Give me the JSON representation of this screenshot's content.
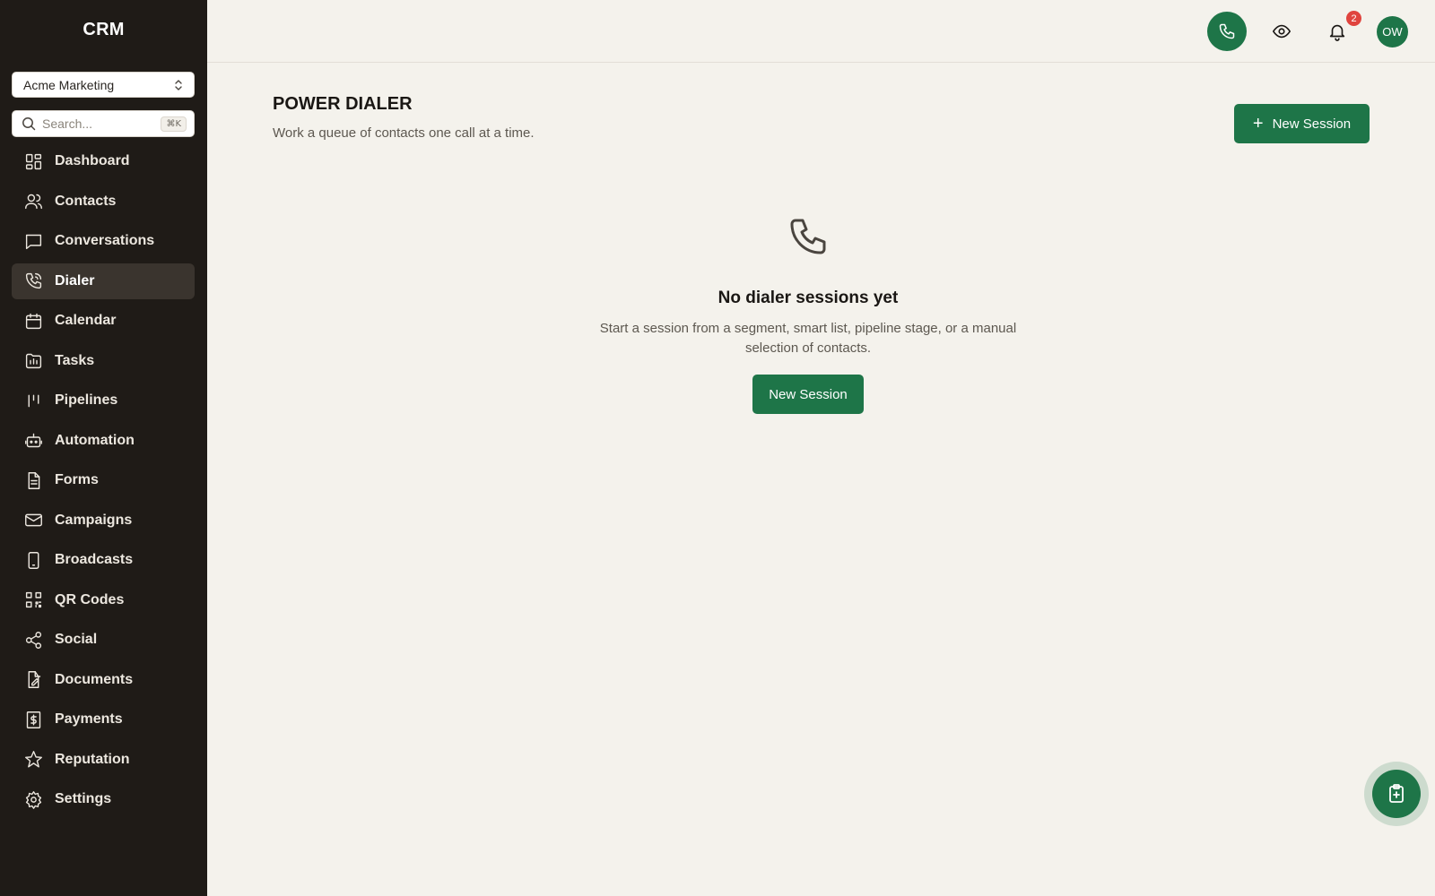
{
  "app": {
    "brand": "CRM"
  },
  "sidebar": {
    "org": "Acme Marketing",
    "search": {
      "placeholder": "Search...",
      "shortcut": "⌘K"
    },
    "items": [
      {
        "label": "Dashboard",
        "icon": "dashboard-icon",
        "active": false
      },
      {
        "label": "Contacts",
        "icon": "contacts-icon",
        "active": false
      },
      {
        "label": "Conversations",
        "icon": "conversations-icon",
        "active": false
      },
      {
        "label": "Dialer",
        "icon": "phone-icon",
        "active": true
      },
      {
        "label": "Calendar",
        "icon": "calendar-icon",
        "active": false
      },
      {
        "label": "Tasks",
        "icon": "tasks-icon",
        "active": false
      },
      {
        "label": "Pipelines",
        "icon": "pipelines-icon",
        "active": false
      },
      {
        "label": "Automation",
        "icon": "robot-icon",
        "active": false
      },
      {
        "label": "Forms",
        "icon": "forms-icon",
        "active": false
      },
      {
        "label": "Campaigns",
        "icon": "mail-icon",
        "active": false
      },
      {
        "label": "Broadcasts",
        "icon": "mobile-icon",
        "active": false
      },
      {
        "label": "QR Codes",
        "icon": "qr-icon",
        "active": false
      },
      {
        "label": "Social",
        "icon": "share-icon",
        "active": false
      },
      {
        "label": "Documents",
        "icon": "document-edit-icon",
        "active": false
      },
      {
        "label": "Payments",
        "icon": "payments-icon",
        "active": false
      },
      {
        "label": "Reputation",
        "icon": "star-icon",
        "active": false
      },
      {
        "label": "Settings",
        "icon": "gear-icon",
        "active": false
      }
    ]
  },
  "topbar": {
    "notifications_count": "2",
    "avatar_initials": "OW"
  },
  "main": {
    "title": "POWER DIALER",
    "subtitle": "Work a queue of contacts one call at a time.",
    "new_session_label": "New Session",
    "empty": {
      "title": "No dialer sessions yet",
      "description": "Start a session from a segment, smart list, pipeline stage, or a manual selection of contacts.",
      "button_label": "New Session"
    }
  },
  "colors": {
    "accent": "#1e7548",
    "sidebar_bg": "#1f1b17",
    "page_bg": "#f4f2ec",
    "badge": "#e0443e"
  }
}
